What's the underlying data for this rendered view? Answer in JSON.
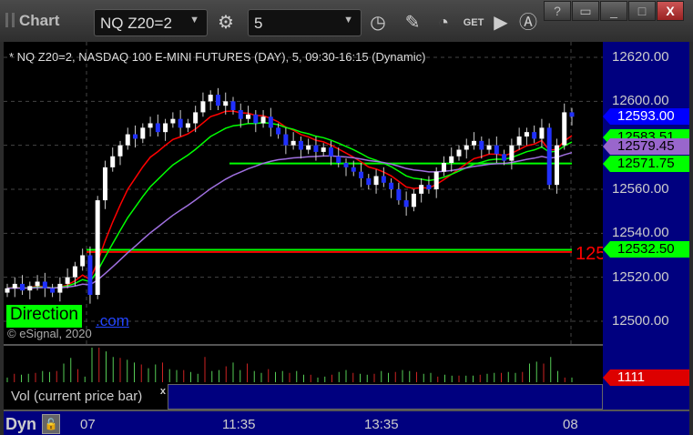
{
  "window": {
    "title": "Chart",
    "symbol": "NQ Z20=2",
    "interval": "5",
    "buttons": [
      "?",
      "restore",
      "minimize",
      "maximize",
      "X"
    ]
  },
  "toolbar_icons": [
    "settings-icon",
    "clock-icon",
    "pencil-icon",
    "studies-icon",
    "get-icon",
    "play-icon",
    "alert-icon"
  ],
  "chart": {
    "header": "* NQ Z20=2, NASDAQ 100 E-MINI FUTURES (DAY), 5, 09:30-16:15 (Dynamic)",
    "direction_label": "Direction",
    "link_suffix": ".com",
    "copyright": "© eSignal, 2020",
    "level_label_partial": "125"
  },
  "price_axis": {
    "labels": [
      "12620.00",
      "12600.00",
      "12560.00",
      "12540.00",
      "12520.00",
      "12500.00"
    ],
    "label_values": [
      12620,
      12600,
      12560,
      12540,
      12520,
      12500
    ],
    "tags": [
      {
        "text": "12593.00",
        "value": 12593,
        "color": "#0000ff",
        "fg": "#ffffff"
      },
      {
        "text": "12583.51",
        "value": 12583.51,
        "color": "#00ff00",
        "fg": "#000000"
      },
      {
        "text": "12579.45",
        "value": 12579.45,
        "color": "#9966cc",
        "fg": "#000000"
      },
      {
        "text": "12571.75",
        "value": 12571.75,
        "color": "#00ff00",
        "fg": "#000000"
      },
      {
        "text": "12532.50",
        "value": 12532.5,
        "color": "#00ff00",
        "fg": "#000000"
      }
    ]
  },
  "volume": {
    "legend": "Vol (current price bar)",
    "close": "x",
    "current": "1111"
  },
  "time_axis": {
    "dyn": "Dyn",
    "labels": [
      {
        "text": "07"
      },
      {
        "text": "11:35"
      },
      {
        "text": "13:35"
      },
      {
        "text": "08"
      }
    ]
  },
  "chart_data": {
    "type": "candlestick",
    "ylim": [
      12493,
      12625
    ],
    "closes": [
      12515,
      12517,
      12514,
      12516,
      12518,
      12515,
      12513,
      12517,
      12520,
      12525,
      12530,
      12512,
      12555,
      12570,
      12575,
      12580,
      12585,
      12583,
      12588,
      12590,
      12586,
      12590,
      12592,
      12588,
      12590,
      12595,
      12600,
      12603,
      12598,
      12600,
      12596,
      12592,
      12594,
      12590,
      12593,
      12588,
      12585,
      12580,
      12582,
      12578,
      12580,
      12577,
      12579,
      12575,
      12572,
      12570,
      12568,
      12565,
      12562,
      12566,
      12563,
      12560,
      12555,
      12552,
      12558,
      12562,
      12560,
      12568,
      12572,
      12575,
      12578,
      12580,
      12582,
      12578,
      12580,
      12576,
      12573,
      12580,
      12584,
      12586,
      12583,
      12588,
      12562,
      12580,
      12595,
      12593
    ],
    "volumes": [
      5,
      9,
      8,
      9,
      10,
      12,
      11,
      12,
      20,
      26,
      14,
      6,
      37,
      37,
      33,
      27,
      26,
      24,
      21,
      19,
      15,
      19,
      21,
      14,
      13,
      13,
      11,
      9,
      27,
      12,
      13,
      17,
      21,
      13,
      20,
      12,
      10,
      14,
      11,
      12,
      10,
      12,
      8,
      8,
      5,
      6,
      8,
      11,
      13,
      10,
      9,
      8,
      9,
      12,
      10,
      11,
      13,
      12,
      11,
      9,
      10,
      6,
      8,
      7,
      7,
      7,
      7,
      8,
      9,
      10,
      10,
      11,
      10,
      11,
      20,
      22,
      20,
      27,
      12,
      5,
      5
    ],
    "horizontal_levels": [
      {
        "value": 12571.75,
        "color": "#00ff00",
        "from_bar": 30
      },
      {
        "value": 12532.5,
        "color": "#00ff00",
        "from_bar": 11
      },
      {
        "value": 12531.5,
        "color": "#ff0000",
        "from_bar": 11
      }
    ]
  }
}
